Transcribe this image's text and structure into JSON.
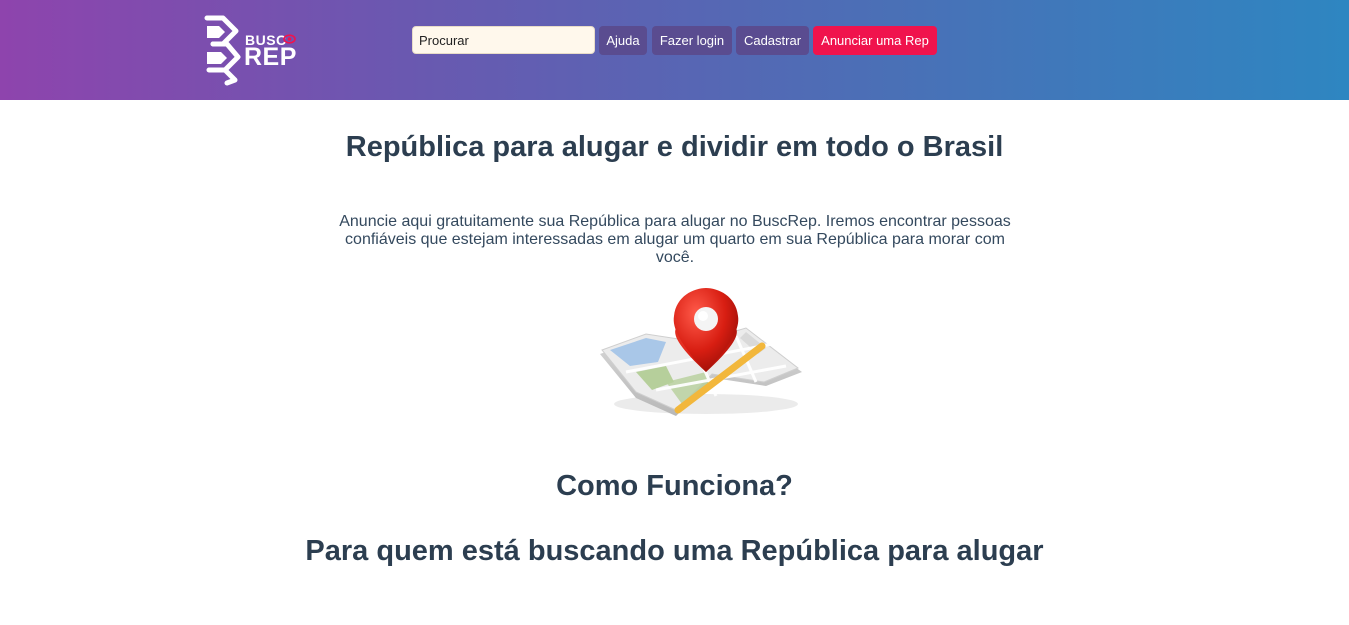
{
  "header": {
    "logo": {
      "top_text": "BUSC",
      "bottom_text": "REP"
    },
    "search": {
      "placeholder": "Procurar"
    },
    "nav": {
      "help": "Ajuda",
      "login": "Fazer login",
      "signup": "Cadastrar",
      "advertise": "Anunciar uma Rep"
    }
  },
  "main": {
    "title": "República para alugar e dividir em todo o Brasil",
    "intro": "Anuncie aqui gratuitamente sua República para alugar no BuscRep. Iremos encontrar pessoas confiáveis que estejam interessadas em alugar um quarto em sua República para morar com você.",
    "illustration_icon": "map-pin-icon",
    "how_title": "Como Funciona?",
    "seek_title": "Para quem está buscando uma República para alugar"
  },
  "colors": {
    "header_gradient_start": "#8e44ad",
    "header_gradient_end": "#2e86c1",
    "nav_button": "#5a4c90",
    "cta_button": "#f0134d",
    "heading_text": "#2c3e50"
  }
}
